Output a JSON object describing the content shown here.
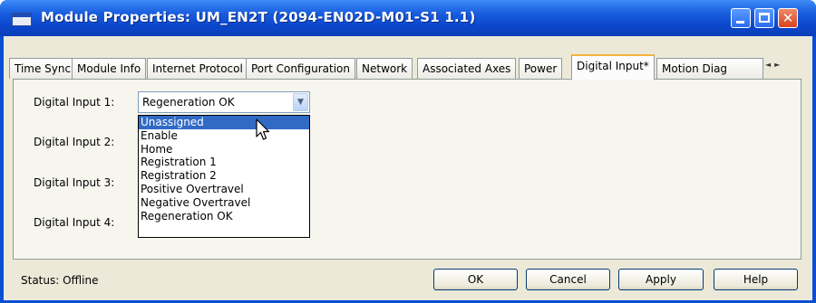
{
  "window": {
    "title": "Module Properties: UM_EN2T (2094-EN02D-M01-S1 1.1)",
    "controls": {
      "minimize": "minimize-icon",
      "maximize": "maximize-icon",
      "close": "close-icon",
      "close_glyph": "✕"
    }
  },
  "tabs": [
    {
      "label": "Time Sync",
      "active": false
    },
    {
      "label": "Module Info",
      "active": false
    },
    {
      "label": "Internet Protocol",
      "active": false
    },
    {
      "label": "Port Configuration",
      "active": false
    },
    {
      "label": "Network",
      "active": false
    },
    {
      "label": "Associated Axes",
      "active": false
    },
    {
      "label": "Power",
      "active": false
    },
    {
      "label": "Digital Input*",
      "active": true
    },
    {
      "label": "Motion Diag",
      "active": false
    }
  ],
  "tab_scroll": {
    "left": "◄",
    "right": "►"
  },
  "digital_inputs": [
    {
      "label": "Digital Input 1:"
    },
    {
      "label": "Digital Input 2:"
    },
    {
      "label": "Digital Input 3:"
    },
    {
      "label": "Digital Input 4:"
    }
  ],
  "combo": {
    "value": "Regeneration OK",
    "arrow": "▼",
    "options": [
      "Unassigned",
      "Enable",
      "Home",
      "Registration 1",
      "Registration 2",
      "Positive Overtravel",
      "Negative Overtravel",
      "Regeneration OK"
    ],
    "highlighted_option": "Unassigned"
  },
  "status": {
    "text": "Status:  Offline"
  },
  "buttons": {
    "ok": "OK",
    "cancel": "Cancel",
    "apply": "Apply",
    "help": "Help"
  },
  "colors": {
    "titlebar": "#0b47cc",
    "selection": "#316ac5",
    "active_tab_accent": "#f6b33d",
    "dialog_bg": "#ece9d8"
  }
}
